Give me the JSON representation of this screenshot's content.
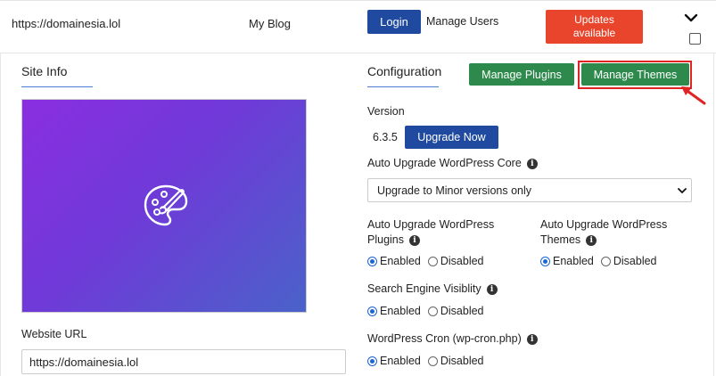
{
  "header": {
    "domain": "https://domainesia.lol",
    "blog_title": "My Blog",
    "login_label": "Login",
    "manage_users_label": "Manage Users",
    "updates_label": "Updates available"
  },
  "site_info": {
    "title": "Site Info",
    "website_url_label": "Website URL",
    "website_url_value": "https://domainesia.lol"
  },
  "configuration": {
    "title": "Configuration",
    "manage_plugins_label": "Manage Plugins",
    "manage_themes_label": "Manage Themes",
    "version_label": "Version",
    "version_value": "6.3.5",
    "upgrade_now_label": "Upgrade Now",
    "auto_core_label": "Auto Upgrade WordPress Core",
    "auto_core_selected": "Upgrade to Minor versions only",
    "auto_plugins_label_line1": "Auto Upgrade WordPress",
    "auto_plugins_label_line2": "Plugins",
    "auto_themes_label_line1": "Auto Upgrade WordPress",
    "auto_themes_label_line2": "Themes",
    "search_visibility_label": "Search Engine Visiblity",
    "cron_label": "WordPress Cron (wp-cron.php)",
    "enabled_label": "Enabled",
    "disabled_label": "Disabled",
    "selected_option": "Enabled"
  },
  "colors": {
    "primary_blue": "#1f4aa0",
    "green": "#2e8a4c",
    "updates_red": "#e8452c",
    "highlight_red": "#e02424"
  },
  "icons": {
    "header_toggle": "chevron-down-icon",
    "preview": "palette-icon",
    "info": "info-icon",
    "annotation": "arrow-pointer-icon"
  }
}
